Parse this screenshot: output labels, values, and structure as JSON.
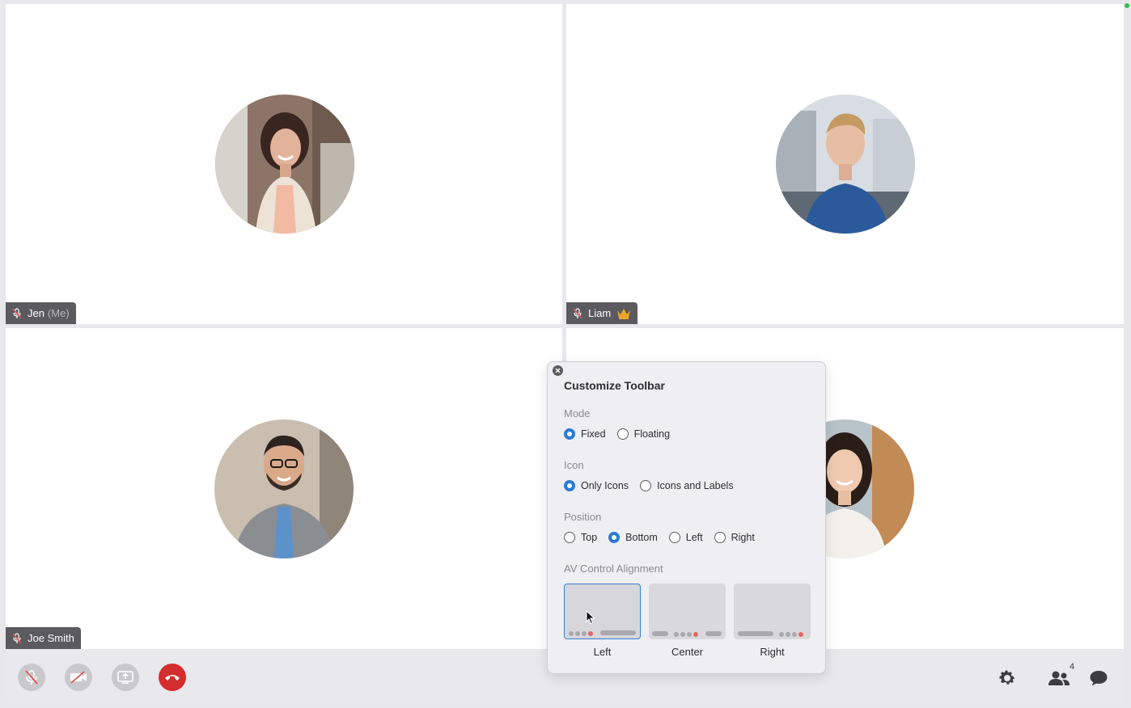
{
  "participants": [
    {
      "name": "Jen",
      "suffix": "(Me)",
      "muted": true,
      "host": false
    },
    {
      "name": "Liam",
      "suffix": "",
      "muted": true,
      "host": true
    },
    {
      "name": "Joe Smith",
      "suffix": "",
      "muted": true,
      "host": false
    },
    {
      "name": "",
      "suffix": "",
      "muted": false,
      "host": false
    }
  ],
  "toolbar": {
    "mic": {
      "icon": "mic-off-icon",
      "state": "muted"
    },
    "camera": {
      "icon": "camera-off-icon",
      "state": "off"
    },
    "share": {
      "icon": "share-screen-icon"
    },
    "leave": {
      "icon": "hang-up-icon",
      "color": "#d42d2d"
    },
    "settings": {
      "icon": "gear-icon"
    },
    "participants": {
      "icon": "people-icon",
      "count": "4"
    },
    "chat": {
      "icon": "chat-icon"
    }
  },
  "panel": {
    "title": "Customize Toolbar",
    "mode": {
      "label": "Mode",
      "options": [
        "Fixed",
        "Floating"
      ],
      "selected": "Fixed"
    },
    "icon": {
      "label": "Icon",
      "options": [
        "Only Icons",
        "Icons and Labels"
      ],
      "selected": "Only Icons"
    },
    "position": {
      "label": "Position",
      "options": [
        "Top",
        "Bottom",
        "Left",
        "Right"
      ],
      "selected": "Bottom"
    },
    "alignment": {
      "label": "AV Control Alignment",
      "options": [
        "Left",
        "Center",
        "Right"
      ],
      "selected": "Left"
    }
  },
  "colors": {
    "accent": "#2a7bd6",
    "danger": "#d42d2d",
    "host_crown": "#f0a428",
    "status_online": "#2ec24a"
  }
}
